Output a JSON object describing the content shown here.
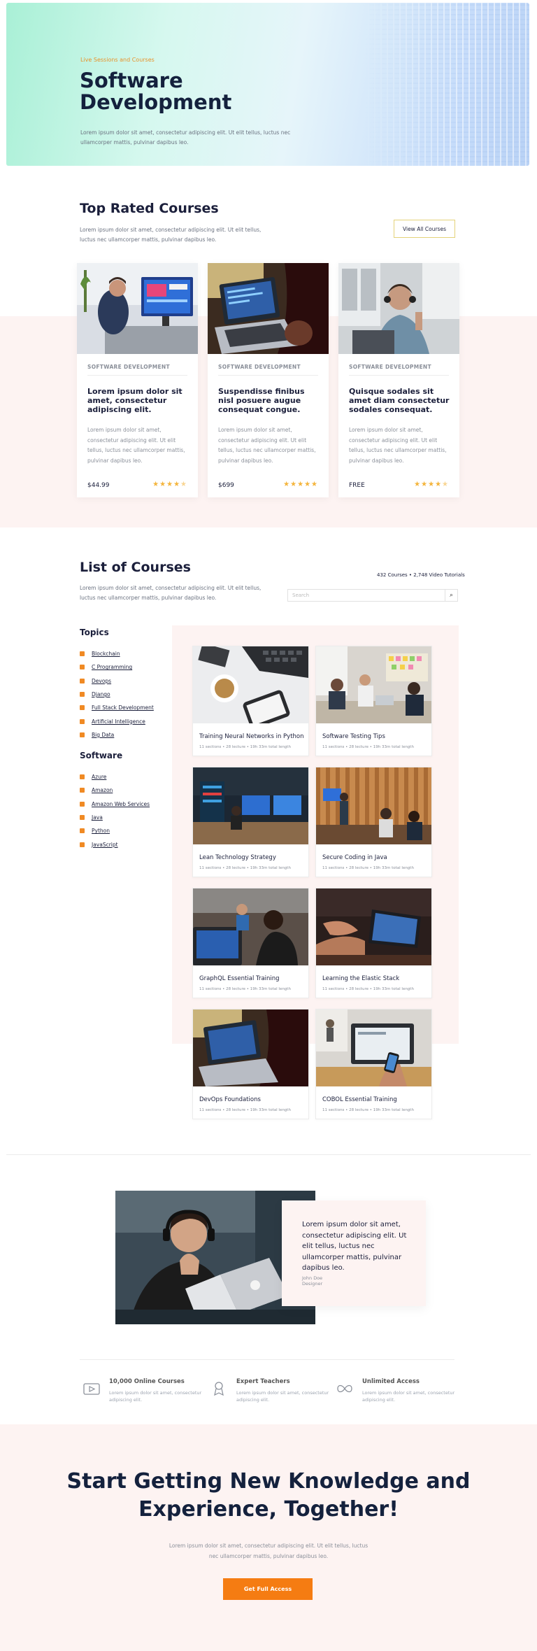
{
  "hero": {
    "eyebrow": "Live Sessions and Courses",
    "title": "Software Development",
    "description": "Lorem ipsum dolor sit amet, consectetur adipiscing elit. Ut elit tellus, luctus nec ullamcorper mattis, pulvinar dapibus leo."
  },
  "top_rated": {
    "title": "Top Rated Courses",
    "description": "Lorem ipsum dolor sit amet, consectetur adipiscing elit. Ut elit tellus, luctus nec ullamcorper mattis, pulvinar dapibus leo.",
    "view_all_label": "View All Courses",
    "courses": [
      {
        "category": "SOFTWARE DEVELOPMENT",
        "title": "Lorem ipsum dolor sit amet, consectetur adipiscing elit.",
        "description": "Lorem ipsum dolor sit amet, consectetur adipiscing elit. Ut elit tellus, luctus nec ullamcorper mattis, pulvinar dapibus leo.",
        "price": "$44.99",
        "rating": 4.5
      },
      {
        "category": "SOFTWARE DEVELOPMENT",
        "title": "Suspendisse finibus nisl posuere augue consequat congue.",
        "description": "Lorem ipsum dolor sit amet, consectetur adipiscing elit. Ut elit tellus, luctus nec ullamcorper mattis, pulvinar dapibus leo.",
        "price": "$699",
        "rating": 5
      },
      {
        "category": "SOFTWARE DEVELOPMENT",
        "title": "Quisque sodales sit amet diam consectetur sodales consequat.",
        "description": "Lorem ipsum dolor sit amet, consectetur adipiscing elit. Ut elit tellus, luctus nec ullamcorper mattis, pulvinar dapibus leo.",
        "price": "FREE",
        "rating": 4.5
      }
    ]
  },
  "list": {
    "title": "List of Courses",
    "description": "Lorem ipsum dolor sit amet, consectetur adipiscing elit. Ut elit tellus, luctus nec ullamcorper mattis, pulvinar dapibus leo.",
    "stats": "432 Courses • 2,748 Video Tutorials",
    "search_placeholder": "Search",
    "topics_title": "Topics",
    "topics": [
      "Blockchain",
      "C Programming",
      "Devops",
      "Django",
      "Full Stack Development",
      "Artificial Intelligence",
      "Big Data"
    ],
    "software_title": "Software",
    "software": [
      "Azure",
      "Amazon",
      "Amazon Web Services",
      "Java",
      "Python",
      "JavaScript"
    ],
    "courses": [
      {
        "title": "Training Neural Networks in Python",
        "meta": "11 sections • 28 lecture • 19h 33m total length"
      },
      {
        "title": "Software Testing Tips",
        "meta": "11 sections • 28 lecture • 19h 33m total length"
      },
      {
        "title": "Lean Technology Strategy",
        "meta": "11 sections • 28 lecture • 19h 33m total length"
      },
      {
        "title": "Secure Coding in Java",
        "meta": "11 sections • 28 lecture • 19h 33m total length"
      },
      {
        "title": "GraphQL Essential Training",
        "meta": "11 sections • 28 lecture • 19h 33m total length"
      },
      {
        "title": "Learning the Elastic Stack",
        "meta": "11 sections • 28 lecture • 19h 33m total length"
      },
      {
        "title": "DevOps Foundations",
        "meta": "11 sections • 28 lecture • 19h 33m total length"
      },
      {
        "title": "COBOL Essential Training",
        "meta": "11 sections • 28 lecture • 19h 33m total length"
      }
    ]
  },
  "testimonial": {
    "quote": "Lorem ipsum dolor sit amet, consectetur adipiscing elit. Ut elit tellus, luctus nec ullamcorper mattis, pulvinar dapibus leo.",
    "name": "John Doe",
    "role": "Designer"
  },
  "features": [
    {
      "icon": "play-video-icon",
      "title": "10,000 Online Courses",
      "description": "Lorem ipsum dolor sit amet, consectetur adipiscing elit."
    },
    {
      "icon": "award-medal-icon",
      "title": "Expert Teachers",
      "description": "Lorem ipsum dolor sit amet, consectetur adipiscing elit."
    },
    {
      "icon": "infinity-icon",
      "title": "Unlimited Access",
      "description": "Lorem ipsum dolor sit amet, consectetur adipiscing elit."
    }
  ],
  "cta": {
    "title": "Start Getting New Knowledge and Experience, Together!",
    "description": "Lorem ipsum dolor sit amet, consectetur adipiscing elit. Ut elit tellus, luctus nec ullamcorper mattis, pulvinar dapibus leo.",
    "button_label": "Get Full Access"
  },
  "colors": {
    "accent_orange": "#f57c12",
    "navy": "#14213d",
    "star": "#f4b43b",
    "blush": "#fdf3f2"
  }
}
